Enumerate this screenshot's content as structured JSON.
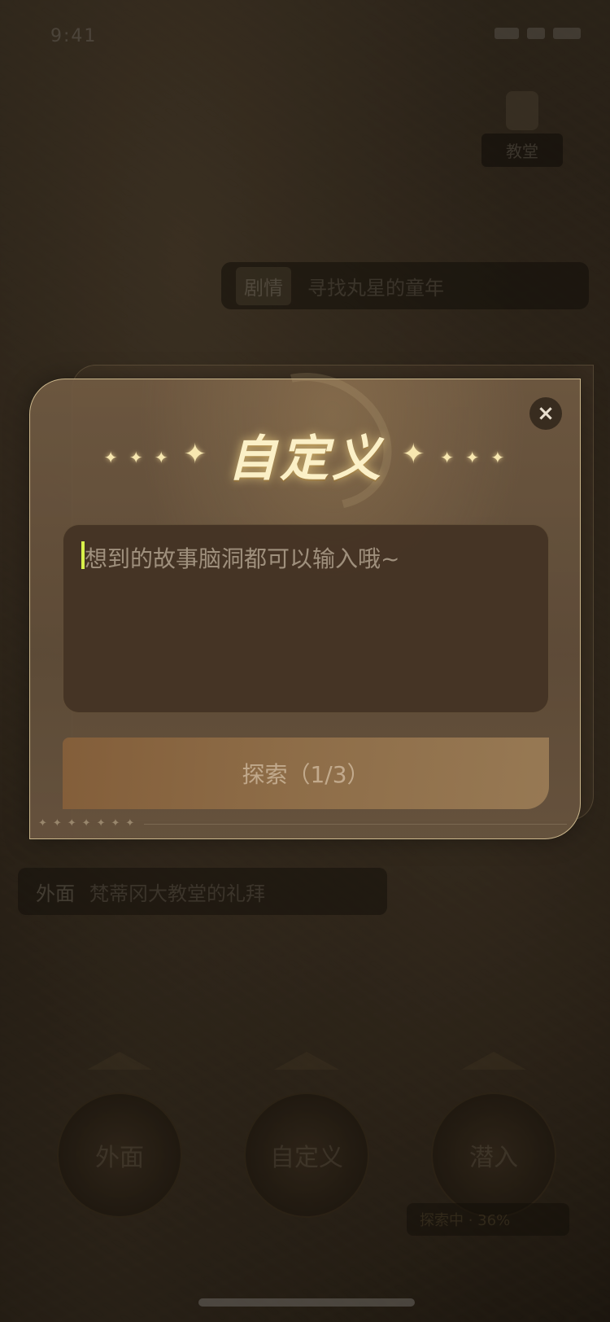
{
  "modal": {
    "title": "自定义",
    "close_icon": "×",
    "input_placeholder": "想到的故事脑洞都可以输入哦~",
    "explore_button": "探索（1/3）",
    "sparkles_left": "✦ ✦ ✦",
    "sparkles_right": "✦ ✦ ✦",
    "deco_stars": "✦✦✦✦✦✦✦"
  },
  "background": {
    "location_tag": "教堂",
    "bubble_chip": "剧情",
    "bubble_text": "寻找丸星的童年",
    "bubble2_chip": "外面",
    "bubble2_text": "梵蒂冈大教堂的礼拜",
    "circle_buttons": [
      "外面",
      "自定义",
      "潜入"
    ],
    "progress_text": "探索中 · 36%"
  },
  "colors": {
    "accent_gold": "#fbf0c7",
    "cursor": "#d8f04a",
    "modal_bg": "#6f5a42"
  }
}
